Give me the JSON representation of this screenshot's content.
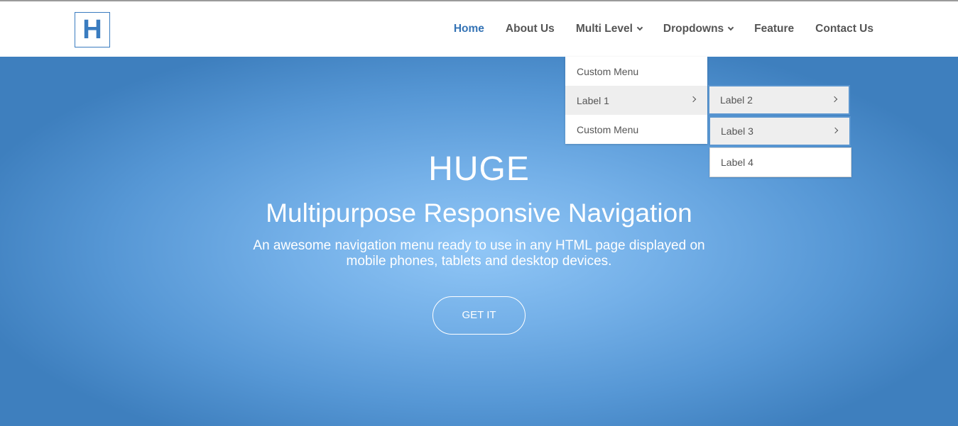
{
  "logo": {
    "letter": "H"
  },
  "nav": {
    "items": [
      {
        "label": "Home",
        "active": true
      },
      {
        "label": "About Us"
      },
      {
        "label": "Multi Level",
        "dropdown": true
      },
      {
        "label": "Dropdowns",
        "dropdown": true
      },
      {
        "label": "Feature"
      },
      {
        "label": "Contact Us"
      }
    ]
  },
  "multi_level_menu": {
    "items": [
      {
        "label": "Custom Menu"
      },
      {
        "label": "Label 1",
        "submenu": true
      },
      {
        "label": "Custom Menu"
      }
    ],
    "submenu": {
      "items": [
        {
          "label": "Label 2",
          "submenu": true
        },
        {
          "label": "Label 3",
          "submenu": true
        },
        {
          "label": "Label 4"
        }
      ]
    }
  },
  "hero": {
    "title": "HUGE",
    "subtitle": "Multipurpose Responsive Navigation",
    "description": "An awesome navigation menu ready to use in any HTML page displayed on mobile phones, tablets and desktop devices.",
    "cta_label": "GET IT"
  },
  "colors": {
    "accent": "#3473b5",
    "nav_text": "#555555",
    "hero_center": "#90c6f6",
    "hero_edge": "#3e7fbe",
    "menu_highlight": "#eeeeee"
  }
}
